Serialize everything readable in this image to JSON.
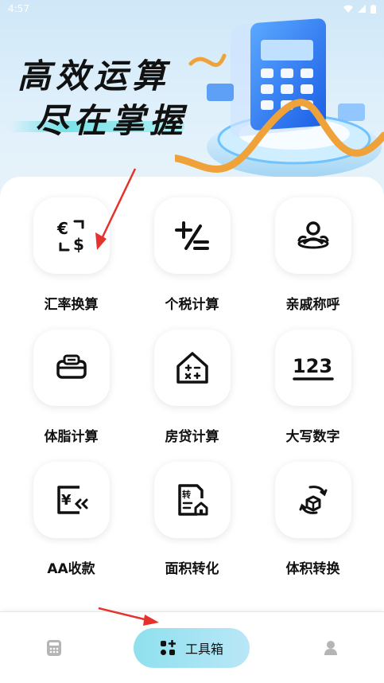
{
  "status_bar": {
    "time": "4:57"
  },
  "banner": {
    "line1": "高效运算",
    "line2": "尽在掌握"
  },
  "tools": [
    {
      "label": "汇率换算",
      "icon": "currency-exchange-icon"
    },
    {
      "label": "个税计算",
      "icon": "plus-minus-icon"
    },
    {
      "label": "亲戚称呼",
      "icon": "relatives-icon"
    },
    {
      "label": "体脂计算",
      "icon": "body-fat-scale-icon"
    },
    {
      "label": "房贷计算",
      "icon": "house-loan-icon"
    },
    {
      "label": "大写数字",
      "icon": "number-123-icon"
    },
    {
      "label": "AA收款",
      "icon": "aa-payment-icon"
    },
    {
      "label": "面积转化",
      "icon": "area-convert-icon"
    },
    {
      "label": "体积转换",
      "icon": "volume-convert-icon"
    }
  ],
  "bottom_nav": {
    "tools_label": "工具箱"
  },
  "colors": {
    "accent_tab": "#a6e4f2",
    "arrow": "#e5322d"
  }
}
